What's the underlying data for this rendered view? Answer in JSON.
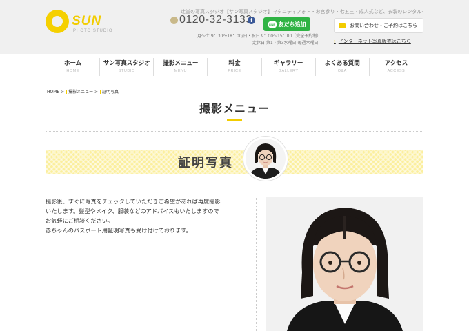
{
  "header": {
    "logo_text": "SUN",
    "logo_sub": "PHOTO STUDIO",
    "tagline": "辻堂の写真スタジオ【サン写真スタジオ】マタニティフォト・お宮参り・七五三・成人式など、衣装のレンタルもあります。",
    "phone": "0120-32-3133",
    "facebook_icon": "facebook-icon",
    "line_label": "友だち追加",
    "line_badge": "LINE",
    "hours": "月〜土 9：30〜18：00/日・祝日 9：00〜15：00（完全予約制）",
    "closed": "定休日 第1・第3水曜日 毎週木曜日",
    "contact_label": "お問い合わせ・ご予約はこちら",
    "shop_arrow": "›",
    "shop_label": "インターネット写真販売はこちら"
  },
  "nav": {
    "items": [
      {
        "label": "ホーム",
        "en": "HOME"
      },
      {
        "label": "サン写真スタジオ",
        "en": "STUDIO"
      },
      {
        "label": "撮影メニュー",
        "en": "MENU"
      },
      {
        "label": "料金",
        "en": "PRICE"
      },
      {
        "label": "ギャラリー",
        "en": "GALLERY"
      },
      {
        "label": "よくある質問",
        "en": "Q&A"
      },
      {
        "label": "アクセス",
        "en": "ACCESS"
      }
    ]
  },
  "breadcrumb": {
    "home": "HOME",
    "sep": ">",
    "menu": "撮影メニュー",
    "current": "証明写真"
  },
  "page": {
    "title": "撮影メニュー",
    "section_title": "証明写真",
    "description": [
      "撮影後、すぐに写真をチェックしていただきご希望があれば再度撮影",
      "いたします。髪型やメイク、服装などのアドバイスもいたしますので",
      "お気軽にご相談ください。",
      "赤ちゃんのパスポート用証明写真も受け付けております。"
    ]
  },
  "colors": {
    "accent": "#f2cc00",
    "banner": "#fbef9e",
    "line_green": "#2fb344",
    "header_bg": "#f0f0f0"
  }
}
